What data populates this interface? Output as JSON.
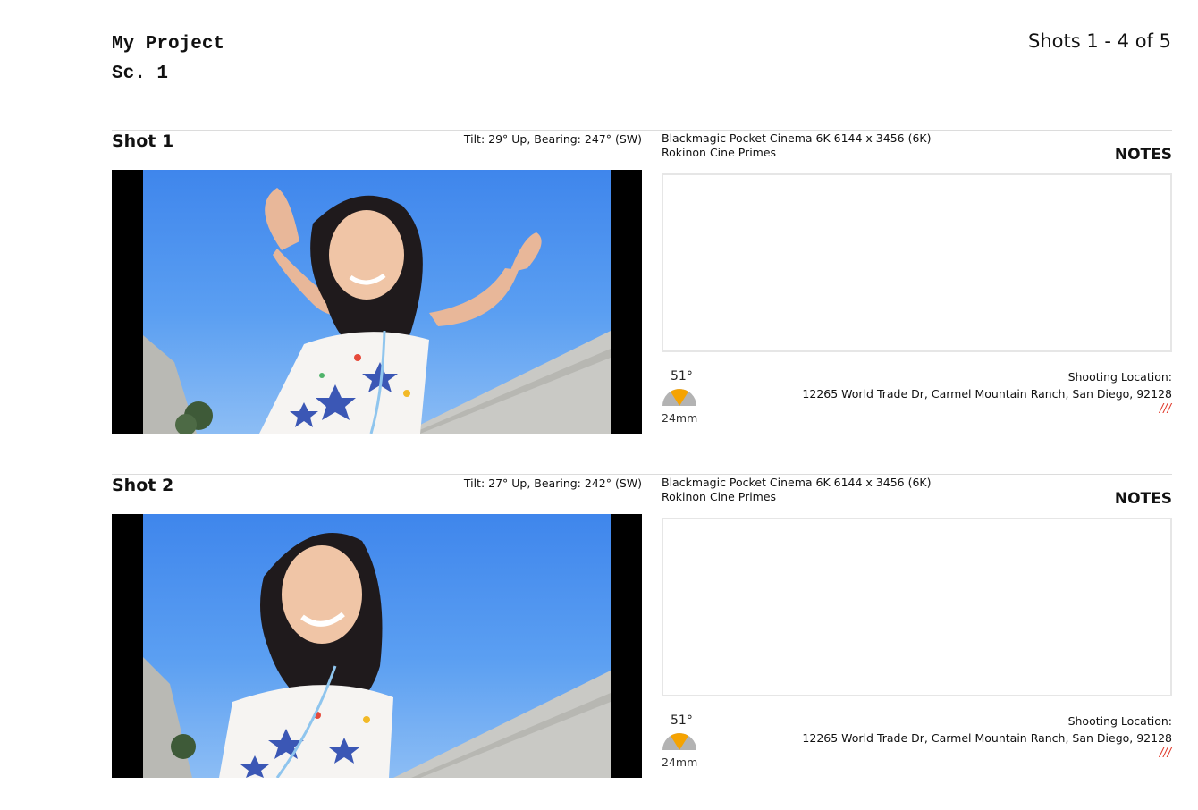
{
  "header": {
    "project_title": "My Project",
    "scene": "Sc. 1",
    "shot_range": "Shots 1 - 4 of 5"
  },
  "colors": {
    "fov_wedge": "#f5a302",
    "fov_dial": "#b3b3b3",
    "location_marker": "#e03a2b"
  },
  "shots": [
    {
      "title": "Shot 1",
      "tilt_bearing": "Tilt: 29° Up, Bearing: 247° (SW)",
      "camera": "Blackmagic Pocket Cinema 6K 6144 x 3456 (6K)",
      "lens": "Rokinon Cine Primes",
      "notes_label": "NOTES",
      "notes": "",
      "fov": "51°",
      "focal_length": "24mm",
      "location_label": "Shooting Location:",
      "location_address": "12265 World Trade Dr, Carmel Mountain Ranch, San Diego, 92128",
      "location_marker": "///"
    },
    {
      "title": "Shot 2",
      "tilt_bearing": "Tilt: 27° Up, Bearing: 242° (SW)",
      "camera": "Blackmagic Pocket Cinema 6K 6144 x 3456 (6K)",
      "lens": "Rokinon Cine Primes",
      "notes_label": "NOTES",
      "notes": "",
      "fov": "51°",
      "focal_length": "24mm",
      "location_label": "Shooting Location:",
      "location_address": "12265 World Trade Dr, Carmel Mountain Ranch, San Diego, 92128",
      "location_marker": "///"
    }
  ]
}
